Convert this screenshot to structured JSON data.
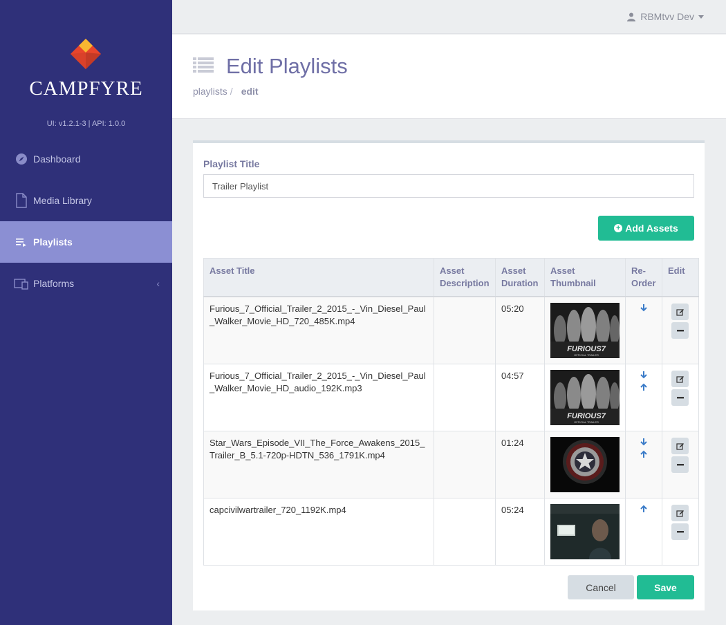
{
  "brand": {
    "name": "CAMPFYRE",
    "version": "UI: v1.2.1-3  |  API: 1.0.0"
  },
  "sidebar": {
    "items": [
      {
        "label": "Dashboard",
        "icon": "compass-icon"
      },
      {
        "label": "Media Library",
        "icon": "file-icon"
      },
      {
        "label": "Playlists",
        "icon": "playlist-icon",
        "active": true
      },
      {
        "label": "Platforms",
        "icon": "devices-icon"
      }
    ],
    "collapse_glyph": "‹"
  },
  "topbar": {
    "user_name": "RBMtvv Dev"
  },
  "header": {
    "title": "Edit Playlists",
    "breadcrumb": {
      "parent": "playlists",
      "separator": "/",
      "current": "edit"
    }
  },
  "form": {
    "title_label": "Playlist Title",
    "title_value": "Trailer Playlist",
    "add_assets_label": "Add Assets",
    "cancel_label": "Cancel",
    "save_label": "Save"
  },
  "table": {
    "headers": {
      "title": "Asset Title",
      "description": "Asset Description",
      "duration": "Asset Duration",
      "thumbnail": "Asset Thumbnail",
      "reorder": "Re-Order",
      "edit": "Edit"
    },
    "rows": [
      {
        "title": "Furious_7_Official_Trailer_2_2015_-_Vin_Diesel_Paul_Walker_Movie_HD_720_485K.mp4",
        "description": "",
        "duration": "05:20",
        "thumb_text": "FURIOUS7",
        "thumb_sub": "OFFICIAL TRAILER"
      },
      {
        "title": "Furious_7_Official_Trailer_2_2015_-_Vin_Diesel_Paul_Walker_Movie_HD_audio_192K.mp3",
        "description": "",
        "duration": "04:57",
        "thumb_text": "FURIOUS7",
        "thumb_sub": "OFFICIAL TRAILER"
      },
      {
        "title": "Star_Wars_Episode_VII_The_Force_Awakens_2015_Trailer_B_5.1-720p-HDTN_536_1791K.mp4",
        "description": "",
        "duration": "01:24"
      },
      {
        "title": "capcivilwartrailer_720_1192K.mp4",
        "description": "",
        "duration": "05:24"
      }
    ]
  },
  "colors": {
    "sidebar": "#2f3079",
    "active_nav": "#8b8fd3",
    "accent": "#21bc94",
    "arrow": "#3a7bc8"
  }
}
